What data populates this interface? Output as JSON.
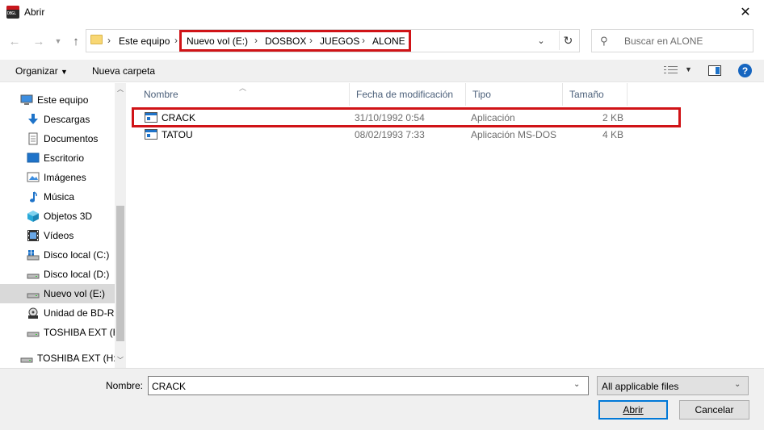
{
  "window": {
    "title": "Abrir",
    "app_icon_text": "DBGL"
  },
  "address": {
    "crumbs": [
      "Este equipo",
      "Nuevo vol (E:)",
      "DOSBOX",
      "JUEGOS",
      "ALONE"
    ],
    "search_placeholder": "Buscar en ALONE"
  },
  "toolbar": {
    "organize": "Organizar",
    "new_folder": "Nueva carpeta"
  },
  "sidebar": {
    "items": [
      {
        "label": "Este equipo",
        "icon": "computer-icon"
      },
      {
        "label": "Descargas",
        "icon": "download-icon"
      },
      {
        "label": "Documentos",
        "icon": "documents-icon"
      },
      {
        "label": "Escritorio",
        "icon": "desktop-icon"
      },
      {
        "label": "Imágenes",
        "icon": "pictures-icon"
      },
      {
        "label": "Música",
        "icon": "music-icon"
      },
      {
        "label": "Objetos 3D",
        "icon": "objects-3d-icon"
      },
      {
        "label": "Vídeos",
        "icon": "videos-icon"
      },
      {
        "label": "Disco local (C:)",
        "icon": "drive-c-icon"
      },
      {
        "label": "Disco local (D:)",
        "icon": "drive-icon"
      },
      {
        "label": "Nuevo vol (E:)",
        "icon": "drive-icon",
        "selected": true
      },
      {
        "label": "Unidad de BD-RE",
        "icon": "bd-drive-icon"
      },
      {
        "label": "TOSHIBA EXT (H:)",
        "icon": "drive-icon"
      },
      {
        "label": "TOSHIBA EXT (H:)",
        "icon": "drive-icon"
      }
    ]
  },
  "columns": {
    "name": "Nombre",
    "modified": "Fecha de modificación",
    "type": "Tipo",
    "size": "Tamaño"
  },
  "files": [
    {
      "name": "CRACK",
      "modified": "31/10/1992 0:54",
      "type": "Aplicación",
      "size": "2 KB"
    },
    {
      "name": "TATOU",
      "modified": "08/02/1993 7:33",
      "type": "Aplicación MS-DOS",
      "size": "4 KB"
    }
  ],
  "bottom": {
    "name_label": "Nombre:",
    "name_value": "CRACK",
    "filetype": "All applicable files",
    "open_button": "Abrir",
    "cancel_button": "Cancelar"
  },
  "colors": {
    "highlight": "#d01317",
    "accent": "#0078d7"
  }
}
